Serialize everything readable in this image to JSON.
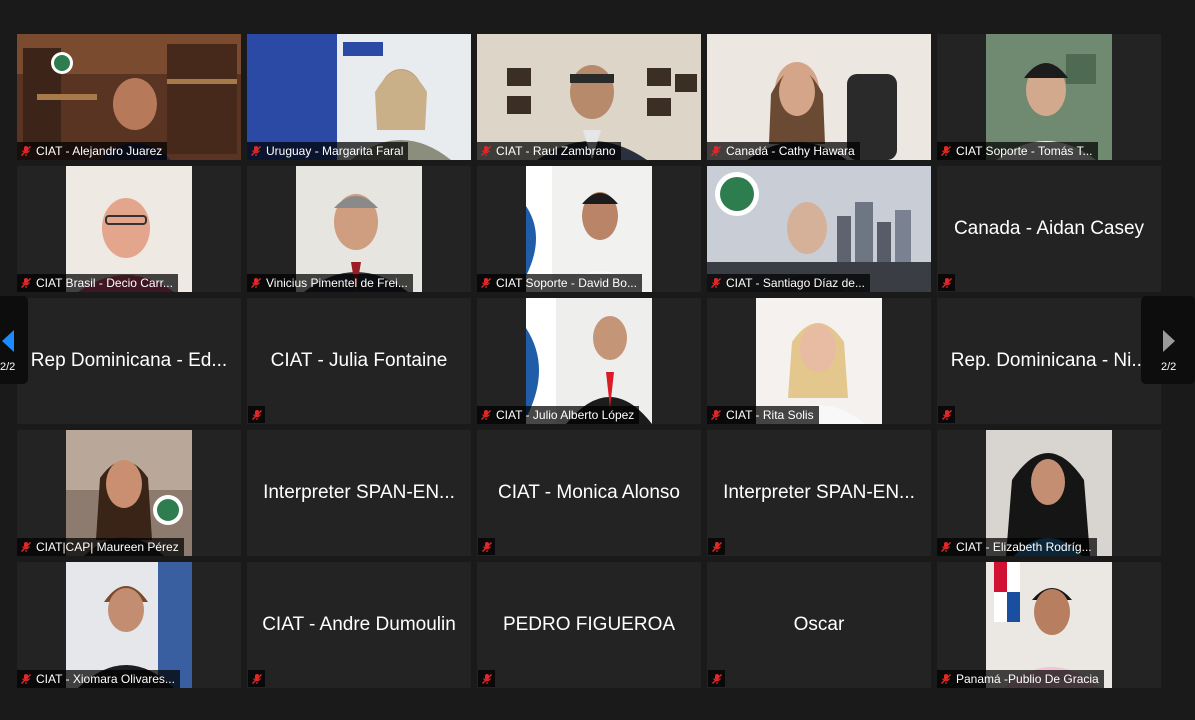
{
  "pagination": {
    "left_label": "2/2",
    "right_label": "2/2"
  },
  "colors": {
    "accent": "#0e72ed",
    "muted_mic": "#e02828",
    "tile_bg": "#232323",
    "page_bg": "#1a1a1a"
  },
  "participants": [
    {
      "name": "CIAT - Alejandro Juarez",
      "video": true
    },
    {
      "name": "Uruguay - Margarita Faral",
      "video": true
    },
    {
      "name": "CIAT - Raul Zambrano",
      "video": true
    },
    {
      "name": "Canadá - Cathy Hawara",
      "video": true
    },
    {
      "name": "CIAT Soporte - Tomás T...",
      "video": true
    },
    {
      "name": "CIAT Brasil - Decio Carr...",
      "video": true
    },
    {
      "name": "Vinicius Pimentel de Frei...",
      "video": true
    },
    {
      "name": "CIAT Soporte - David Bo...",
      "video": true
    },
    {
      "name": "CIAT - Santiago Díaz de...",
      "video": true
    },
    {
      "name": "Canada - Aidan Casey",
      "video": false
    },
    {
      "name": "Rep Dominicana - Ed...",
      "video": false
    },
    {
      "name": "CIAT - Julia Fontaine",
      "video": false
    },
    {
      "name": "CIAT - Julio Alberto López",
      "video": true
    },
    {
      "name": "CIAT - Rita Solis",
      "video": true
    },
    {
      "name": "Rep. Dominicana - Ni...",
      "video": false
    },
    {
      "name": "CIAT|CAP| Maureen Pérez",
      "video": true
    },
    {
      "name": "Interpreter SPAN-EN...",
      "video": false
    },
    {
      "name": "CIAT - Monica Alonso",
      "video": false
    },
    {
      "name": "Interpreter SPAN-EN...",
      "video": false
    },
    {
      "name": "CIAT - Elizabeth Rodríg...",
      "video": true
    },
    {
      "name": "CIAT - Xiomara Olivares...",
      "video": true
    },
    {
      "name": "CIAT - Andre Dumoulin",
      "video": false
    },
    {
      "name": "PEDRO FIGUEROA",
      "video": false
    },
    {
      "name": "Oscar",
      "video": false
    },
    {
      "name": "Panamá -Publio De Gracia",
      "video": true
    }
  ]
}
